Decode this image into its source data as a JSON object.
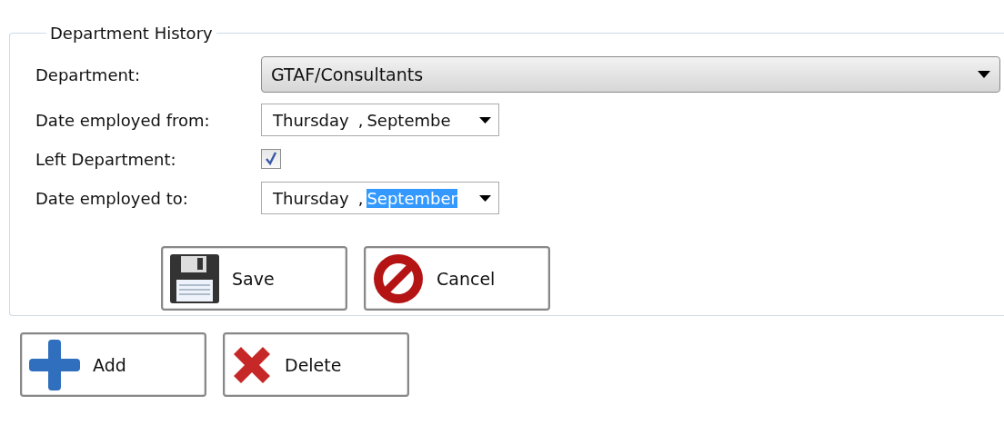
{
  "group": {
    "title": "Department History"
  },
  "department": {
    "label": "Department:",
    "value": "GTAF/Consultants"
  },
  "rows": [
    {
      "kind": "date",
      "label": "Date employed from:",
      "day": "Thursday",
      "separator": ",",
      "month": "Septembe",
      "month_selected": false
    },
    {
      "kind": "check",
      "label": "Left Department:",
      "checked": true
    },
    {
      "kind": "date",
      "label": "Date employed to:",
      "day": "Thursday",
      "separator": ",",
      "month": "September",
      "month_selected": true
    }
  ],
  "form_buttons": [
    {
      "kind": "save",
      "label": "Save"
    },
    {
      "kind": "cancel",
      "label": "Cancel"
    }
  ],
  "list_buttons": [
    {
      "kind": "add",
      "label": "Add"
    },
    {
      "kind": "delete",
      "label": "Delete"
    }
  ]
}
